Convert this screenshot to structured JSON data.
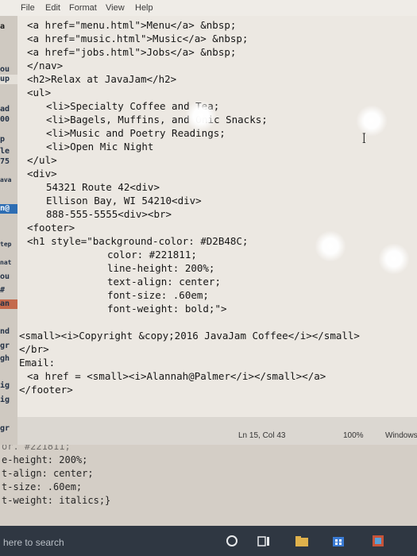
{
  "menu": [
    "File",
    "Edit",
    "Format",
    "View",
    "Help"
  ],
  "background_window_fragments": [
    "a",
    "ou",
    "up",
    "ad",
    "00",
    "p",
    "le",
    "75",
    "ava",
    "n@",
    "tep",
    "nat",
    "ou",
    "#",
    "an",
    "nd",
    "gr",
    "gh",
    "ig",
    "ig",
    "gr"
  ],
  "code_lines": [
    "<a href=\"menu.html\">Menu</a> &nbsp;",
    "<a href=\"music.html\">Music</a> &nbsp;",
    "<a href=\"jobs.html\">Jobs</a> &nbsp;",
    "</nav>",
    "<h2>Relax at JavaJam</h2>",
    "<ul>",
    "<li>Specialty Coffee and Tea;",
    "<li>Bagels, Muffins, and O",
    "nic Snacks;",
    "<li>Music and Poetry Readings;",
    "<li>Open Mic Night",
    "</ul>",
    "<div>",
    "54321 Route 42<div>",
    "Ellison Bay, WI 54210<div>",
    "888-555-5555<div><br>",
    "<footer>",
    "<h1 style=\"background-color: #D2B48C;",
    "color: #221811;",
    "line-height: 200%;",
    "text-align: center;",
    "font-size: .60em;",
    "font-weight: bold;\">",
    "<small><i>Copyright &copy;2016 JavaJam Coffee</i></small>",
    "</br>",
    "Email:",
    "<a href = <small><i>Alannah@Palmer</i></small></a>",
    "</footer>"
  ],
  "status": {
    "position": "Ln 15, Col 43",
    "zoom": "100%",
    "line_ending": "Windows"
  },
  "lower_code_lines": [
    "or. #221811;",
    "e-height: 200%;",
    "t-align: center;",
    "t-size: .60em;",
    "t-weight: italics;}"
  ],
  "taskbar": {
    "search_placeholder": "here to search",
    "icons": [
      "cortana-circle-icon",
      "task-view-icon",
      "folder-icon",
      "store-icon",
      "app-icon"
    ]
  }
}
